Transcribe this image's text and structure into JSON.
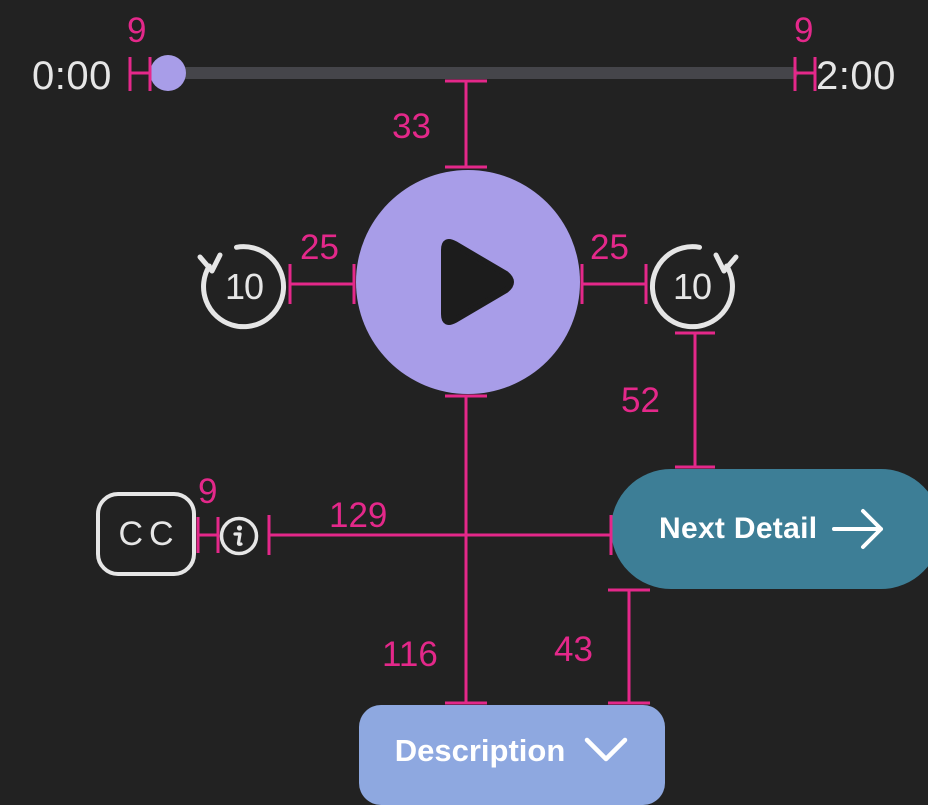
{
  "player": {
    "time_start": "0:00",
    "time_end": "2:00",
    "progress": 0,
    "skip_back_label": "10",
    "skip_forward_label": "10",
    "cc_label": "CC",
    "info_icon": "info-icon",
    "play_icon": "play-icon",
    "skip_back_icon": "replay-10-icon",
    "skip_forward_icon": "forward-10-icon"
  },
  "actions": {
    "next_label": "Next Detail",
    "next_icon": "arrow-right-icon",
    "description_label": "Description",
    "description_icon": "chevron-down-icon"
  },
  "measurements": {
    "slider_left_gap": "9",
    "slider_right_gap": "9",
    "slider_to_play": "33",
    "skip_back_gap": "25",
    "skip_forward_gap": "25",
    "skip_to_next": "52",
    "cc_to_info": "9",
    "info_to_next": "129",
    "play_to_description": "116",
    "next_to_description": "43"
  },
  "colors": {
    "background": "#222222",
    "accent": "#a89de8",
    "next_button": "#3d7e96",
    "description_button": "#8ea8e0",
    "annotation": "#e4288a",
    "foreground": "#e6e6e6"
  }
}
